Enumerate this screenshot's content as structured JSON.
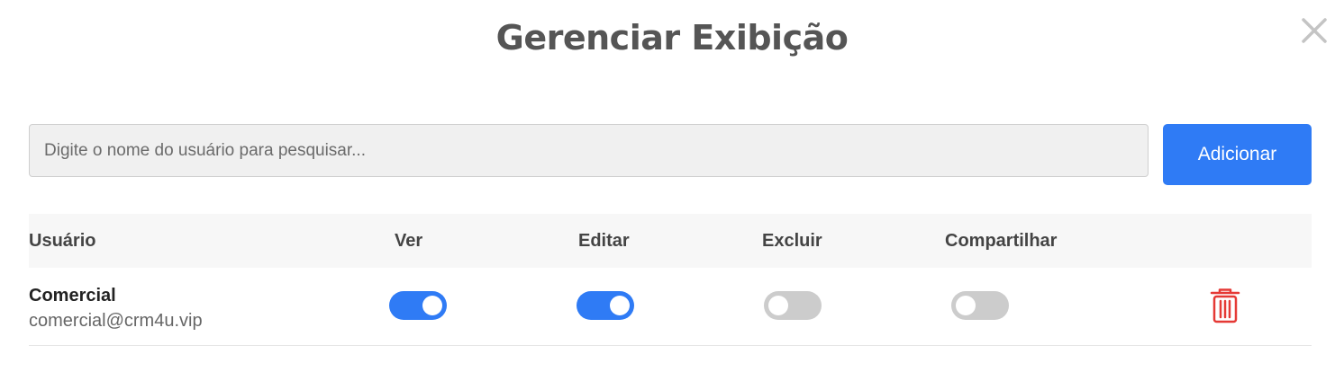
{
  "dialog": {
    "title": "Gerenciar Exibição"
  },
  "search": {
    "placeholder": "Digite o nome do usuário para pesquisar...",
    "value": ""
  },
  "add_button": {
    "label": "Adicionar"
  },
  "table": {
    "headers": {
      "user": "Usuário",
      "view": "Ver",
      "edit": "Editar",
      "delete": "Excluir",
      "share": "Compartilhar"
    },
    "rows": [
      {
        "name": "Comercial",
        "email": "comercial@crm4u.vip",
        "view": true,
        "edit": true,
        "delete": false,
        "share": false
      }
    ]
  },
  "colors": {
    "accent": "#2f7bf5",
    "toggle_off": "#cccccc",
    "danger": "#e53935",
    "title": "#555555"
  },
  "icons": {
    "close": "close-icon",
    "remove": "trash-icon"
  }
}
